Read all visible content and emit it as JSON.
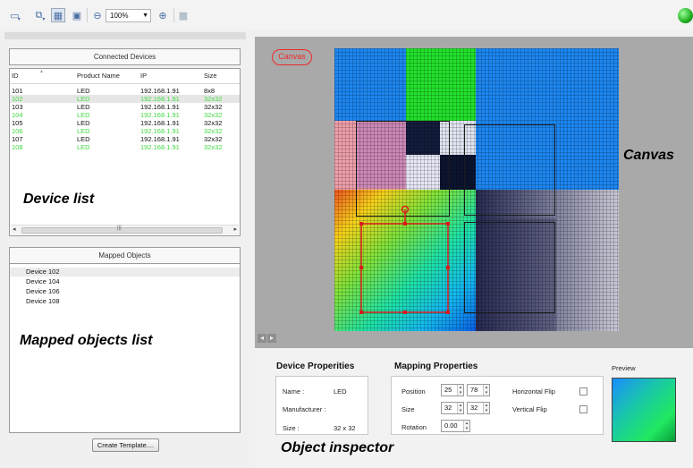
{
  "toolbar": {
    "zoom_value": "100%",
    "icons": [
      "window-icon",
      "monitor-add-icon",
      "grid-icon",
      "image-icon",
      "zoom-out-icon",
      "zoom-in-icon",
      "disabled-tool-icon"
    ],
    "status_color": "#22b322"
  },
  "device_list": {
    "header": "Connected Devices",
    "columns": [
      "ID",
      "Product Name",
      "IP",
      "Size"
    ],
    "rows": [
      {
        "id": "101",
        "name": "LED",
        "ip": "192.168.1.91",
        "size": "8x8",
        "mapped": false
      },
      {
        "id": "102",
        "name": "LED",
        "ip": "192.168.1.91",
        "size": "32x32",
        "mapped": true
      },
      {
        "id": "103",
        "name": "LED",
        "ip": "192.168.1.91",
        "size": "32x32",
        "mapped": false
      },
      {
        "id": "104",
        "name": "LED",
        "ip": "192.168.1.91",
        "size": "32x32",
        "mapped": true
      },
      {
        "id": "105",
        "name": "LED",
        "ip": "192.168.1.91",
        "size": "32x32",
        "mapped": false
      },
      {
        "id": "106",
        "name": "LED",
        "ip": "192.168.1.91",
        "size": "32x32",
        "mapped": true
      },
      {
        "id": "107",
        "name": "LED",
        "ip": "192.168.1.91",
        "size": "32x32",
        "mapped": false
      },
      {
        "id": "108",
        "name": "LED",
        "ip": "192.168.1.91",
        "size": "32x32",
        "mapped": true
      }
    ],
    "mapped_color": "#3fd93f"
  },
  "mapped_objects": {
    "header": "Mapped Objects",
    "items": [
      "Device 102",
      "Device 104",
      "Device 106",
      "Device 108"
    ]
  },
  "create_template_label": "Create Template....",
  "canvas": {
    "badge": "Canvas",
    "accent_color": "#ee2a2a"
  },
  "device_properties": {
    "title": "Device Properities",
    "name_label": "Name :",
    "name_value": "LED",
    "manufacturer_label": "Manufacturer :",
    "manufacturer_value": "",
    "size_label": "Size :",
    "size_value": "32 x 32"
  },
  "mapping_properties": {
    "title": "Mapping Properties",
    "position_label": "Position",
    "position_x": "25",
    "position_y": "78",
    "size_label": "Size",
    "size_w": "32",
    "size_h": "32",
    "rotation_label": "Rotation",
    "rotation_value": "0.00",
    "hflip_label": "Horizontal Flip",
    "vflip_label": "Vertical Flip",
    "hflip": false,
    "vflip": false
  },
  "preview_label": "Preview",
  "annotations": {
    "device_list": "Device list",
    "mapped_objects": "Mapped objects list",
    "canvas": "Canvas",
    "object_inspector": "Object inspector"
  }
}
